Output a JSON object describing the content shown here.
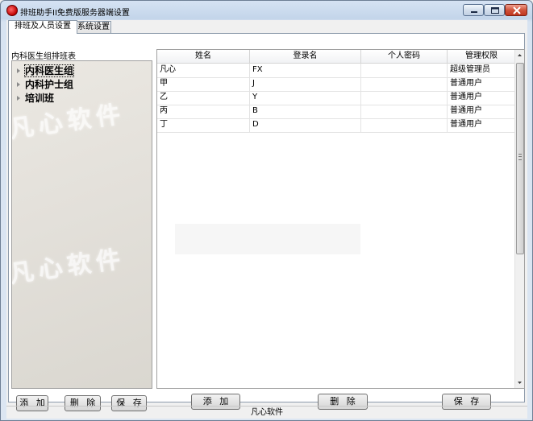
{
  "window": {
    "title": "排班助手II免费版服务器端设置"
  },
  "tabs": [
    {
      "label": "排班及人员设置",
      "active": true
    },
    {
      "label": "系统设置",
      "active": false
    }
  ],
  "left_panel": {
    "caption": "内科医生组排班表",
    "tree_items": [
      {
        "label": "内科医生组",
        "selected": true
      },
      {
        "label": "内科护士组",
        "selected": false
      },
      {
        "label": "培训班",
        "selected": false
      }
    ],
    "watermark": "凡心软件",
    "buttons": {
      "add": "添 加",
      "delete": "删 除",
      "save": "保 存"
    }
  },
  "grid": {
    "columns": [
      "姓名",
      "登录名",
      "个人密码",
      "管理权限"
    ],
    "rows": [
      [
        "凡心",
        "FX",
        "",
        "超级管理员"
      ],
      [
        "甲",
        "J",
        "",
        "普通用户"
      ],
      [
        "乙",
        "Y",
        "",
        "普通用户"
      ],
      [
        "丙",
        "B",
        "",
        "普通用户"
      ],
      [
        "丁",
        "D",
        "",
        "普通用户"
      ]
    ],
    "buttons": {
      "add": "添 加",
      "delete": "删 除",
      "save": "保 存"
    }
  },
  "status_bar": {
    "text": "凡心软件"
  },
  "icons": {
    "app": "app-icon",
    "minimize": "minimize-icon",
    "maximize": "maximize-icon",
    "close": "close-icon",
    "tree_expand": "triangle-right-icon"
  }
}
